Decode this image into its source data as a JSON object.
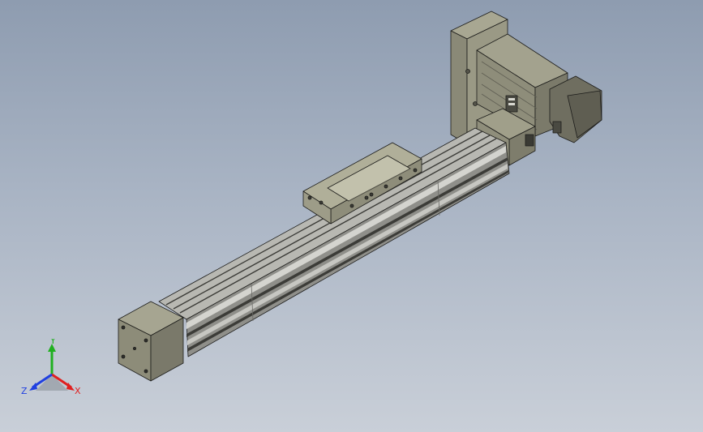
{
  "viewport": {
    "background_top": "#8e9cb0",
    "background_bottom": "#c9cfd8"
  },
  "colors": {
    "body_light": "#9e9d88",
    "body_mid": "#8a8977",
    "body_dark": "#6d6c5e",
    "rail_light": "#c7c7c2",
    "rail_mid": "#8f8f8a",
    "rail_dark": "#3c3c38",
    "outline": "#1c1c1a",
    "axis_x": "#e02020",
    "axis_y": "#20b020",
    "axis_z": "#2040e0"
  },
  "triad": {
    "x_label": "X",
    "y_label": "Y",
    "z_label": "Z",
    "x_icon": "x-axis-arrow-icon",
    "y_icon": "y-axis-arrow-icon",
    "z_icon": "z-axis-arrow-icon"
  },
  "parts": [
    "end-block",
    "linear-rail",
    "carriage-slider",
    "motor-mount-plate",
    "stepper-motor",
    "coupling-housing"
  ]
}
